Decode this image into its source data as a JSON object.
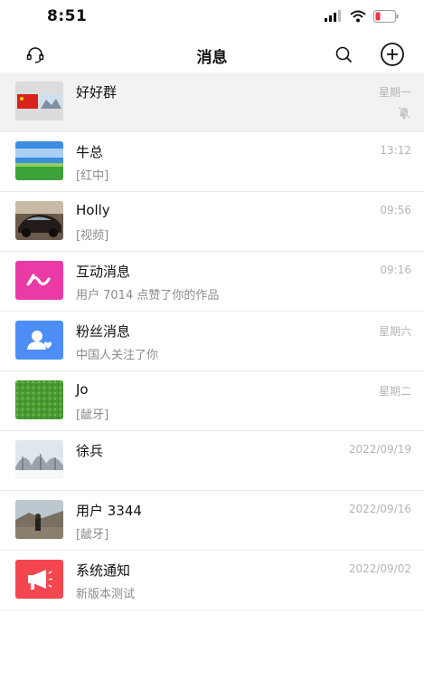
{
  "status_bar": {
    "time": "8:51"
  },
  "header": {
    "title": "消息"
  },
  "conversations": [
    {
      "name": "好好群",
      "preview": "",
      "time": "星期一",
      "muted": true,
      "pinned": true,
      "avatar": "group-flags"
    },
    {
      "name": "牛总",
      "preview": "[红中]",
      "time": "13:12",
      "avatar": "grassland"
    },
    {
      "name": "Holly",
      "preview": "[视频]",
      "time": "09:56",
      "avatar": "car"
    },
    {
      "name": "互动消息",
      "preview": "用户 7014 点赞了你的作品",
      "time": "09:16",
      "avatar": "interaction-icon",
      "color": "#ea3aa6"
    },
    {
      "name": "粉丝消息",
      "preview": "中国人关注了你",
      "time": "星期六",
      "avatar": "fan-icon",
      "color": "#4d8ef6"
    },
    {
      "name": "Jo",
      "preview": "[龇牙]",
      "time": "星期二",
      "avatar": "grass"
    },
    {
      "name": "徐兵",
      "preview": "",
      "time": "2022/09/19",
      "avatar": "snow-trees"
    },
    {
      "name": "用户 3344",
      "preview": "[龇牙]",
      "time": "2022/09/16",
      "avatar": "great-wall"
    },
    {
      "name": "系统通知",
      "preview": "新版本测试",
      "time": "2022/09/02",
      "avatar": "megaphone-icon",
      "color": "#f3464f"
    }
  ]
}
